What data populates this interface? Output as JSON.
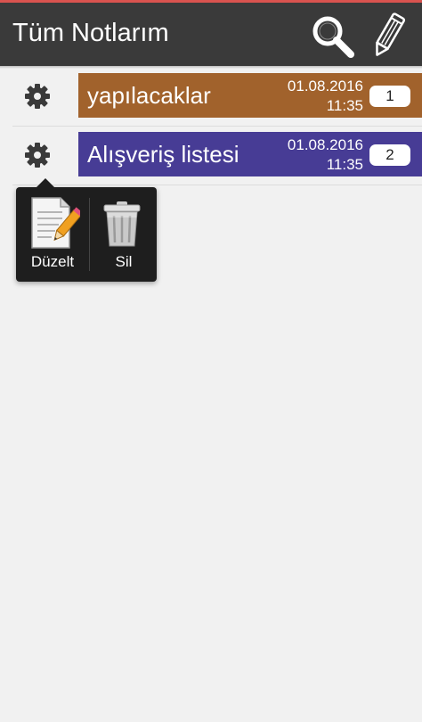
{
  "header": {
    "title": "Tüm Notlarım",
    "search_icon": "search-icon",
    "new_note_icon": "pencil-icon"
  },
  "notes": [
    {
      "title": "yapılacaklar",
      "date": "01.08.2016",
      "time": "11:35",
      "count": "1",
      "color": "#a1622c"
    },
    {
      "title": "Alışveriş listesi",
      "date": "01.08.2016",
      "time": "11:35",
      "count": "2",
      "color": "#473c95"
    }
  ],
  "context_menu": {
    "edit_label": "Düzelt",
    "delete_label": "Sil",
    "edit_icon": "edit-document-icon",
    "delete_icon": "trash-icon"
  },
  "colors": {
    "action_bar": "#3a3a3a",
    "accent": "#d9534f",
    "background": "#f1f1f1"
  }
}
